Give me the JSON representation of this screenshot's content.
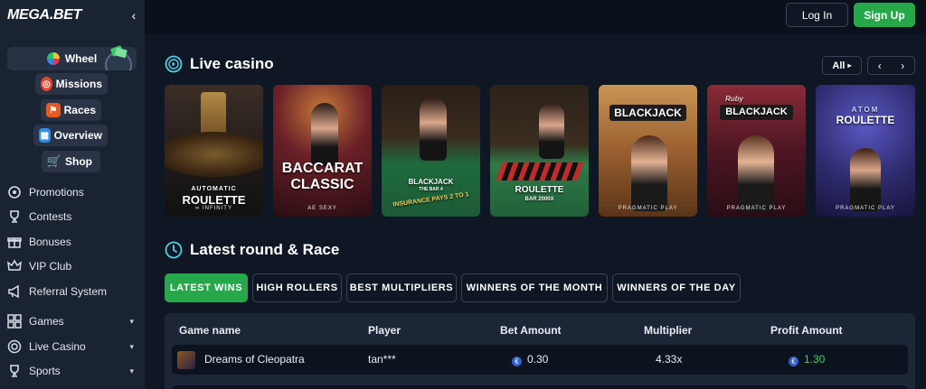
{
  "brand": {
    "logo": "MEGA.BET"
  },
  "header": {
    "login_label": "Log In",
    "signup_label": "Sign Up"
  },
  "sidebar": {
    "wheel_label": "Wheel",
    "pills": [
      {
        "label": "Missions",
        "icon": "target-icon"
      },
      {
        "label": "Races",
        "icon": "checkered-flag-icon"
      },
      {
        "label": "Overview",
        "icon": "grid-icon"
      },
      {
        "label": "Shop",
        "icon": "cart-icon"
      }
    ],
    "items": [
      {
        "label": "Promotions",
        "icon": "gear-star-icon"
      },
      {
        "label": "Contests",
        "icon": "trophy-icon"
      },
      {
        "label": "Bonuses",
        "icon": "gift-icon"
      },
      {
        "label": "VIP Club",
        "icon": "crown-icon"
      },
      {
        "label": "Referral System",
        "icon": "megaphone-icon"
      },
      {
        "label": "Games",
        "icon": "grid-icon",
        "caret": "▾"
      },
      {
        "label": "Live Casino",
        "icon": "chip-icon",
        "caret": "▾"
      },
      {
        "label": "Sports",
        "icon": "trophy-icon",
        "caret": "▾"
      }
    ]
  },
  "live_casino": {
    "title": "Live casino",
    "all_label": "All",
    "cards": [
      {
        "title_top": "AUTOMATIC",
        "title": "ROULETTE",
        "sub": "∞ INFINITY",
        "bg": "#2b2420"
      },
      {
        "title_top": "",
        "title": "BACCARAT CLASSIC",
        "sub": "AE SEXY",
        "bg": "#4a1d24"
      },
      {
        "title_top": "BLACKJACK",
        "title": "THE BAR 4",
        "sub": "INSURANCE PAYS 2 TO 1",
        "bg": "#1f5e3c"
      },
      {
        "title_top": "ROULETTE",
        "title": "BAR 2000X",
        "sub": "",
        "bg": "#2d6a43"
      },
      {
        "title_top": "",
        "title": "BLACKJACK",
        "sub": "PRAGMATIC PLAY",
        "bg": "#a76a35"
      },
      {
        "title_top": "Ruby",
        "title": "BLACKJACK",
        "sub": "PRAGMATIC PLAY",
        "bg": "#5a1e2a"
      },
      {
        "title_top": "ATOM",
        "title": "ROULETTE",
        "sub": "PRAGMATIC PLAY",
        "bg": "#35327a"
      }
    ]
  },
  "latest": {
    "title": "Latest round & Race",
    "tabs": [
      "LATEST WINS",
      "HIGH ROLLERS",
      "BEST MULTIPLIERS",
      "WINNERS OF THE MONTH",
      "WINNERS OF THE DAY"
    ],
    "columns": [
      "Game name",
      "Player",
      "Bet Amount",
      "Multiplier",
      "Profit Amount"
    ],
    "rows": [
      {
        "game": "Dreams of Cleopatra",
        "player": "tan***",
        "bet": "0.30",
        "multiplier": "4.33x",
        "profit": "1.30"
      }
    ]
  },
  "colors": {
    "accent_green": "#26a84a",
    "profit_green": "#3cd26a",
    "coin_blue": "#2f5fd0"
  }
}
